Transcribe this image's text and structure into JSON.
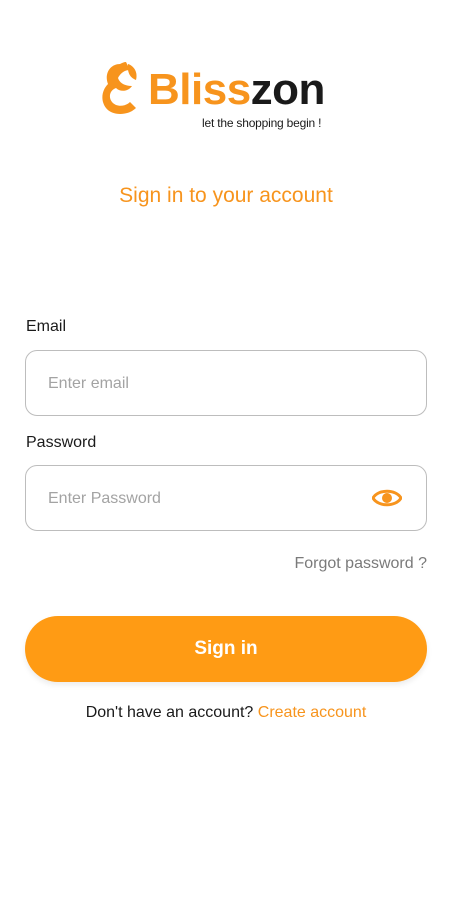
{
  "brand": {
    "name_part1": "Bliss",
    "name_part2": "zon",
    "tagline": "let the shopping begin !",
    "accent_color": "#F7941D",
    "logo_icon": "brand-logo-icon"
  },
  "heading": {
    "subtitle": "Sign in to your account"
  },
  "form": {
    "email_label": "Email",
    "email_placeholder": "Enter email",
    "email_value": "",
    "password_label": "Password",
    "password_placeholder": "Enter Password",
    "password_value": "",
    "password_toggle_icon": "eye-icon",
    "forgot_label": "Forgot password ?",
    "submit_label": "Sign in",
    "button_color": "#FF9B14"
  },
  "footer": {
    "prompt": "Don't have an account? ",
    "create_label": "Create account"
  }
}
